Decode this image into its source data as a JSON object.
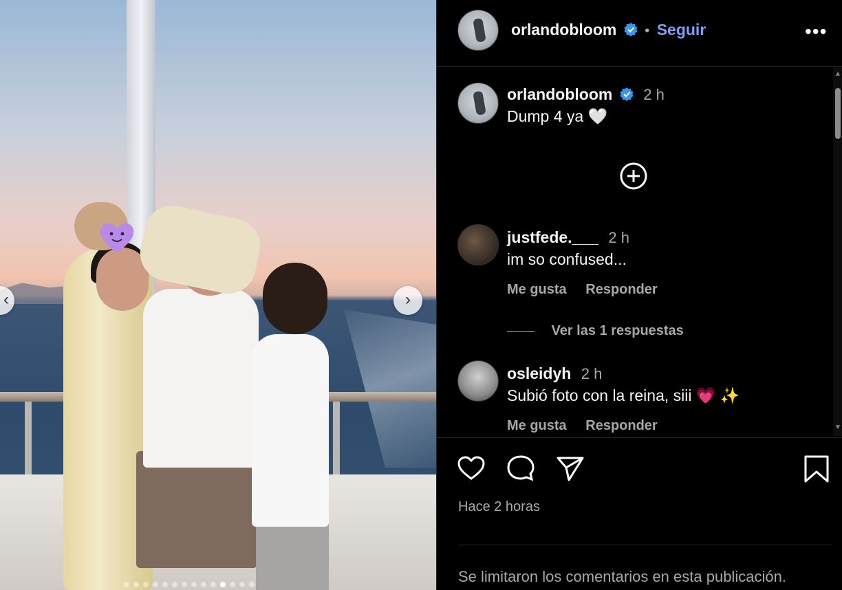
{
  "post": {
    "username": "orlandobloom",
    "follow_label": "Seguir",
    "separator": "•",
    "more_label": "•••",
    "caption_time": "2 h",
    "caption": "Dump 4 ya 🤍",
    "carousel": {
      "total": 14,
      "current": 11
    }
  },
  "comments": [
    {
      "username": "justfede.___",
      "time": "2 h",
      "text": "im so confused...",
      "like_label": "Me gusta",
      "reply_label": "Responder",
      "view_replies": "Ver las 1 respuestas"
    },
    {
      "username": "osleidyh",
      "time": "2 h",
      "text": "Subió foto con la reina, siii 💗 ✨",
      "like_label": "Me gusta",
      "reply_label": "Responder"
    }
  ],
  "footer": {
    "posted_ago": "Hace 2 horas",
    "comments_limited": "Se limitaron los comentarios en esta publicación."
  },
  "colors": {
    "accent": "#7f9cf5",
    "verified": "#3797f0",
    "background": "#000000",
    "muted": "#a8a8a8"
  }
}
